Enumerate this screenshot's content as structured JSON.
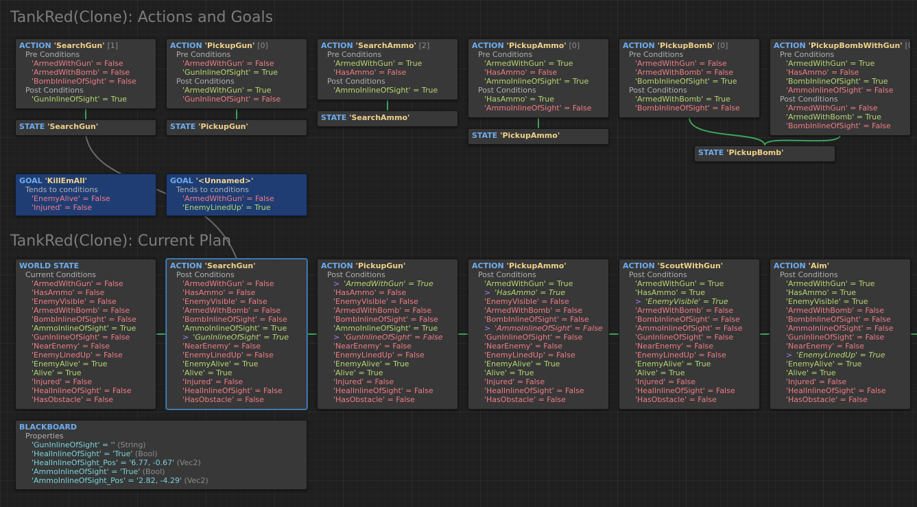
{
  "titles": {
    "actions_goals": "TankRed(Clone): Actions and Goals",
    "current_plan": "TankRed(Clone): Current Plan"
  },
  "labels": {
    "action": "ACTION",
    "state": "STATE",
    "goal": "GOAL",
    "world_state": "WORLD STATE",
    "blackboard": "BLACKBOARD",
    "pre_conditions": "Pre Conditions",
    "post_conditions": "Post Conditions",
    "tends": "Tends to conditions",
    "current_conditions": "Current Conditions",
    "properties": "Properties"
  },
  "colors": {
    "true": "#b6d672",
    "false": "#f07c86",
    "wire": "#3fa35a",
    "header": "#6dadf0",
    "name": "#f0d28a"
  },
  "actions": [
    {
      "name": "'SearchGun'",
      "count": "[1]",
      "pre": [
        [
          "'ArmedWithGun'",
          "False"
        ],
        [
          "'ArmedWithBomb'",
          "False"
        ],
        [
          "'BombInlineOfSight'",
          "False"
        ]
      ],
      "post": [
        [
          "'GunInlineOfSight'",
          "True"
        ]
      ]
    },
    {
      "name": "'PickupGun'",
      "count": "[0]",
      "pre": [
        [
          "'ArmedWithGun'",
          "False"
        ],
        [
          "'GunInlineOfSight'",
          "True"
        ]
      ],
      "post": [
        [
          "'ArmedWithGun'",
          "True"
        ],
        [
          "'GunInlineOfSight'",
          "False"
        ]
      ]
    },
    {
      "name": "'SearchAmmo'",
      "count": "[2]",
      "pre": [
        [
          "'ArmedWithGun'",
          "True"
        ],
        [
          "'HasAmmo'",
          "False"
        ]
      ],
      "post": [
        [
          "'AmmoInlineOfSight'",
          "True"
        ]
      ]
    },
    {
      "name": "'PickupAmmo'",
      "count": "[0]",
      "pre": [
        [
          "'ArmedWithGun'",
          "True"
        ],
        [
          "'HasAmmo'",
          "False"
        ],
        [
          "'AmmoInlineOfSight'",
          "True"
        ]
      ],
      "post": [
        [
          "'HasAmmo'",
          "True"
        ],
        [
          "'AmmoInlineOfSight'",
          "False"
        ]
      ]
    },
    {
      "name": "'PickupBomb'",
      "count": "[0]",
      "pre": [
        [
          "'ArmedWithGun'",
          "False"
        ],
        [
          "'ArmedWithBomb'",
          "False"
        ],
        [
          "'BombInlineOfSight'",
          "True"
        ]
      ],
      "post": [
        [
          "'ArmedWithBomb'",
          "True"
        ],
        [
          "'BombInlineOfSight'",
          "False"
        ]
      ]
    },
    {
      "name": "'PickupBombWithGun'",
      "count": "[0]",
      "pre": [
        [
          "'ArmedWithGun'",
          "True"
        ],
        [
          "'HasAmmo'",
          "False"
        ],
        [
          "'BombInlineOfSight'",
          "True"
        ],
        [
          "'AmmoInlineOfSight'",
          "False"
        ]
      ],
      "post": [
        [
          "'ArmedWithGun'",
          "False"
        ],
        [
          "'ArmedWithBomb'",
          "True"
        ],
        [
          "'BombInlineOfSight'",
          "False"
        ]
      ]
    }
  ],
  "states": [
    "'SearchGun'",
    "'PickupGun'",
    "'SearchAmmo'",
    "'PickupAmmo'",
    "'PickupBomb'"
  ],
  "goals": [
    {
      "name": "'KillEmAll'",
      "conds": [
        [
          "'EnemyAlive'",
          "False"
        ],
        [
          "'Injured'",
          "False"
        ]
      ]
    },
    {
      "name": "'<Unnamed>'",
      "conds": [
        [
          "'ArmedWithGun'",
          "False"
        ],
        [
          "'EnemyLinedUp'",
          "True"
        ]
      ]
    }
  ],
  "world_state": [
    [
      "'ArmedWithGun'",
      "False"
    ],
    [
      "'HasAmmo'",
      "False"
    ],
    [
      "'EnemyVisible'",
      "False"
    ],
    [
      "'ArmedWithBomb'",
      "False"
    ],
    [
      "'BombInlineOfSight'",
      "False"
    ],
    [
      "'AmmoInlineOfSight'",
      "True"
    ],
    [
      "'GunInlineOfSight'",
      "False"
    ],
    [
      "'NearEnemy'",
      "False"
    ],
    [
      "'EnemyLinedUp'",
      "False"
    ],
    [
      "'EnemyAlive'",
      "True"
    ],
    [
      "'Alive'",
      "True"
    ],
    [
      "'Injured'",
      "False"
    ],
    [
      "'HealInlineOfSight'",
      "False"
    ],
    [
      "'HasObstacle'",
      "False"
    ]
  ],
  "plan": [
    {
      "name": "'SearchGun'",
      "changed": "'GunInlineOfSight'",
      "conds": [
        [
          "'ArmedWithGun'",
          "False"
        ],
        [
          "'HasAmmo'",
          "False"
        ],
        [
          "'EnemyVisible'",
          "False"
        ],
        [
          "'ArmedWithBomb'",
          "False"
        ],
        [
          "'BombInlineOfSight'",
          "False"
        ],
        [
          "'AmmoInlineOfSight'",
          "True"
        ],
        [
          "'GunInlineOfSight'",
          "True"
        ],
        [
          "'NearEnemy'",
          "False"
        ],
        [
          "'EnemyLinedUp'",
          "False"
        ],
        [
          "'EnemyAlive'",
          "True"
        ],
        [
          "'Alive'",
          "True"
        ],
        [
          "'Injured'",
          "False"
        ],
        [
          "'HealInlineOfSight'",
          "False"
        ],
        [
          "'HasObstacle'",
          "False"
        ]
      ]
    },
    {
      "name": "'PickupGun'",
      "changed": "'ArmedWithGun','GunInlineOfSight'",
      "conds": [
        [
          "'ArmedWithGun'",
          "True"
        ],
        [
          "'HasAmmo'",
          "False"
        ],
        [
          "'EnemyVisible'",
          "False"
        ],
        [
          "'ArmedWithBomb'",
          "False"
        ],
        [
          "'BombInlineOfSight'",
          "False"
        ],
        [
          "'AmmoInlineOfSight'",
          "True"
        ],
        [
          "'GunInlineOfSight'",
          "False"
        ],
        [
          "'NearEnemy'",
          "False"
        ],
        [
          "'EnemyLinedUp'",
          "False"
        ],
        [
          "'EnemyAlive'",
          "True"
        ],
        [
          "'Alive'",
          "True"
        ],
        [
          "'Injured'",
          "False"
        ],
        [
          "'HealInlineOfSight'",
          "False"
        ],
        [
          "'HasObstacle'",
          "False"
        ]
      ]
    },
    {
      "name": "'PickupAmmo'",
      "changed": "'HasAmmo','AmmoInlineOfSight'",
      "conds": [
        [
          "'ArmedWithGun'",
          "True"
        ],
        [
          "'HasAmmo'",
          "True"
        ],
        [
          "'EnemyVisible'",
          "False"
        ],
        [
          "'ArmedWithBomb'",
          "False"
        ],
        [
          "'BombInlineOfSight'",
          "False"
        ],
        [
          "'AmmoInlineOfSight'",
          "False"
        ],
        [
          "'GunInlineOfSight'",
          "False"
        ],
        [
          "'NearEnemy'",
          "False"
        ],
        [
          "'EnemyLinedUp'",
          "False"
        ],
        [
          "'EnemyAlive'",
          "True"
        ],
        [
          "'Alive'",
          "True"
        ],
        [
          "'Injured'",
          "False"
        ],
        [
          "'HealInlineOfSight'",
          "False"
        ],
        [
          "'HasObstacle'",
          "False"
        ]
      ]
    },
    {
      "name": "'ScoutWithGun'",
      "changed": "'EnemyVisible'",
      "conds": [
        [
          "'ArmedWithGun'",
          "True"
        ],
        [
          "'HasAmmo'",
          "True"
        ],
        [
          "'EnemyVisible'",
          "True"
        ],
        [
          "'ArmedWithBomb'",
          "False"
        ],
        [
          "'BombInlineOfSight'",
          "False"
        ],
        [
          "'AmmoInlineOfSight'",
          "False"
        ],
        [
          "'GunInlineOfSight'",
          "False"
        ],
        [
          "'NearEnemy'",
          "False"
        ],
        [
          "'EnemyLinedUp'",
          "False"
        ],
        [
          "'EnemyAlive'",
          "True"
        ],
        [
          "'Alive'",
          "True"
        ],
        [
          "'Injured'",
          "False"
        ],
        [
          "'HealInlineOfSight'",
          "False"
        ],
        [
          "'HasObstacle'",
          "False"
        ]
      ]
    },
    {
      "name": "'Aim'",
      "changed": "'EnemyLinedUp'",
      "conds": [
        [
          "'ArmedWithGun'",
          "True"
        ],
        [
          "'HasAmmo'",
          "True"
        ],
        [
          "'EnemyVisible'",
          "True"
        ],
        [
          "'ArmedWithBomb'",
          "False"
        ],
        [
          "'BombInlineOfSight'",
          "False"
        ],
        [
          "'AmmoInlineOfSight'",
          "False"
        ],
        [
          "'GunInlineOfSight'",
          "False"
        ],
        [
          "'NearEnemy'",
          "False"
        ],
        [
          "'EnemyLinedUp'",
          "True"
        ],
        [
          "'EnemyAlive'",
          "True"
        ],
        [
          "'Alive'",
          "True"
        ],
        [
          "'Injured'",
          "False"
        ],
        [
          "'HealInlineOfSight'",
          "False"
        ],
        [
          "'HasObstacle'",
          "False"
        ]
      ]
    }
  ],
  "blackboard": [
    {
      "key": "'GunInlineOfSight'",
      "value": "''",
      "type": "(String)"
    },
    {
      "key": "'HealInlineOfSight'",
      "value": "'True'",
      "type": "(Bool)"
    },
    {
      "key": "'HealInlineOfSight_Pos'",
      "value": "'6.77, -0.67'",
      "type": "(Vec2)"
    },
    {
      "key": "'AmmoInlineOfSight'",
      "value": "'True'",
      "type": "(Bool)"
    },
    {
      "key": "'AmmoInlineOfSight_Pos'",
      "value": "'2.82, -4.29'",
      "type": "(Vec2)"
    }
  ]
}
